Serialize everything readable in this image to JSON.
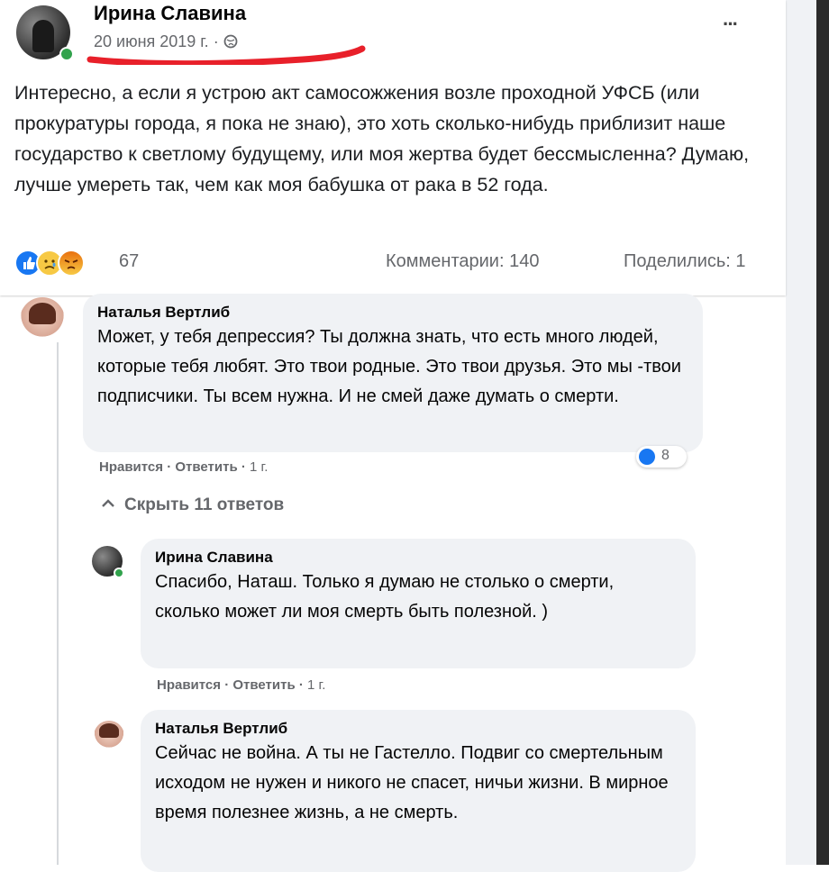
{
  "post": {
    "author": "Ирина Славина",
    "date": "20 июня 2019 г.",
    "privacy_separator": "·",
    "more_label": "···",
    "text": "Интересно, а если я устрою акт самосожжения возле проходной УФСБ (или прокуратуры города, я пока не знаю), это хоть сколько-нибудь приблизит наше государство к светлому будущему, или моя жертва будет бессмысленна? Думаю, лучше умереть так, чем как моя бабушка от рака в 52 года.",
    "reaction_count": "67",
    "comments_label": "Комментарии: 140",
    "shares_label": "Поделились: 1",
    "reactions": [
      "like-icon",
      "sad-icon",
      "angry-icon"
    ]
  },
  "comments": [
    {
      "author": "Наталья Вертлиб",
      "text": "Может, у тебя депрессия? Ты должна знать, что есть много людей, которые тебя любят. Это твои родные. Это твои друзья. Это мы -твои подписчики. Ты всем нужна. И не смей даже думать о смерти.",
      "like_label": "Нравится",
      "reply_label": "Ответить",
      "time": "1 г.",
      "reaction_count": "8"
    }
  ],
  "hide_replies_label": "Скрыть 11 ответов",
  "replies": [
    {
      "author": "Ирина Славина",
      "text": "Спасибо, Наташ. Только я думаю не столько о смерти, сколько может ли моя смерть быть полезной. )",
      "like_label": "Нравится",
      "reply_label": "Ответить",
      "time": "1 г."
    },
    {
      "author": "Наталья Вертлиб",
      "text": "Сейчас не война. А ты не Гастелло. Подвиг со смертельным исходом не нужен и никого не спасет, ничьи жизни. В мирное время полезнее жизнь, а не смерть."
    }
  ],
  "colors": {
    "background": "#ffffff",
    "bubble": "#f0f2f5",
    "secondary_text": "#65676b",
    "like_blue": "#1877f2",
    "online_green": "#31a24c",
    "annotation_red": "#e8202a"
  }
}
